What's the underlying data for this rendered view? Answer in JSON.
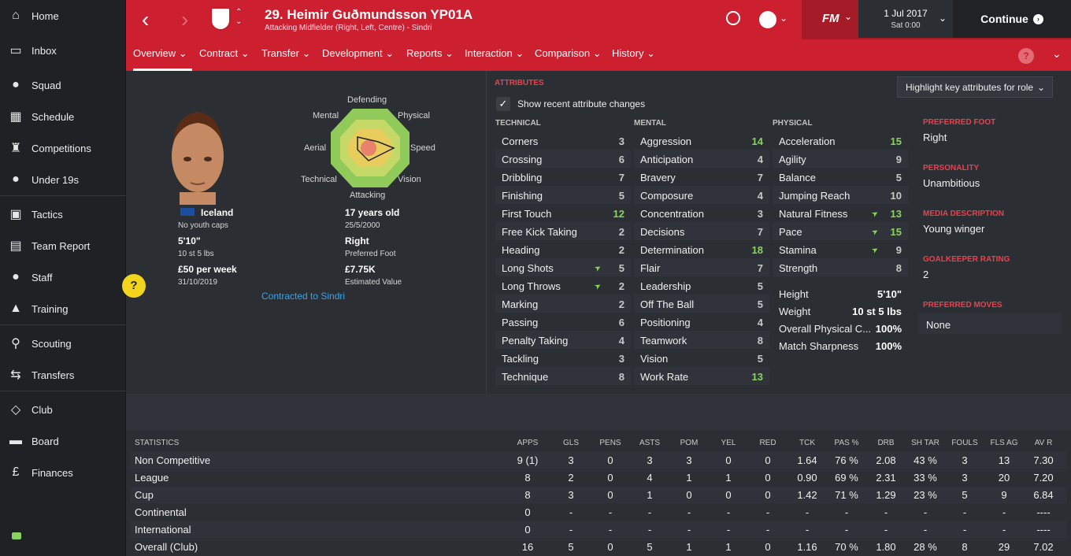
{
  "sidebar": {
    "items": [
      {
        "label": "Home",
        "icon": "home-icon"
      },
      {
        "label": "Inbox",
        "icon": "inbox-icon"
      },
      {
        "label": "Squad",
        "icon": "squad-icon"
      },
      {
        "label": "Schedule",
        "icon": "calendar-icon"
      },
      {
        "label": "Competitions",
        "icon": "trophy-icon"
      },
      {
        "label": "Under 19s",
        "icon": "under19s-icon"
      },
      {
        "label": "Tactics",
        "icon": "tactics-icon"
      },
      {
        "label": "Team Report",
        "icon": "report-icon"
      },
      {
        "label": "Staff",
        "icon": "staff-icon"
      },
      {
        "label": "Training",
        "icon": "training-icon"
      },
      {
        "label": "Scouting",
        "icon": "search-icon"
      },
      {
        "label": "Transfers",
        "icon": "transfers-icon"
      },
      {
        "label": "Club",
        "icon": "shield-icon"
      },
      {
        "label": "Board",
        "icon": "briefcase-icon"
      },
      {
        "label": "Finances",
        "icon": "pound-icon"
      }
    ]
  },
  "header": {
    "title": "29. Heimir Guðmundsson YP01A",
    "subtitle": "Attacking Midfielder (Right, Left, Centre) - Sindri",
    "fm_label": "FM",
    "date": "1 Jul 2017",
    "time": "Sat 0:00",
    "continue": "Continue"
  },
  "tabs": [
    "Overview",
    "Contract",
    "Transfer",
    "Development",
    "Reports",
    "Interaction",
    "Comparison",
    "History"
  ],
  "profile": {
    "nation": "Iceland",
    "caps": "No youth caps",
    "height": "5'10\"",
    "weight": "10 st 5 lbs",
    "wage": "£50 per week",
    "contract_end": "31/10/2019",
    "age": "17 years old",
    "dob": "25/5/2000",
    "foot": "Right",
    "foot_label": "Preferred Foot",
    "value": "£7.75K",
    "value_label": "Estimated Value",
    "contract_link": "Contracted to Sindri",
    "help": "?"
  },
  "radar": {
    "labels": [
      "Defending",
      "Physical",
      "Speed",
      "Vision",
      "Attacking",
      "Technical",
      "Aerial",
      "Mental"
    ]
  },
  "attributes": {
    "section_label": "ATTRIBUTES",
    "highlight_dropdown": "Highlight key attributes for role",
    "show_changes": "Show recent attribute changes",
    "technical_label": "TECHNICAL",
    "mental_label": "MENTAL",
    "physical_label": "PHYSICAL",
    "technical": [
      {
        "name": "Corners",
        "value": "3"
      },
      {
        "name": "Crossing",
        "value": "6"
      },
      {
        "name": "Dribbling",
        "value": "7"
      },
      {
        "name": "Finishing",
        "value": "5"
      },
      {
        "name": "First Touch",
        "value": "12",
        "hi": true
      },
      {
        "name": "Free Kick Taking",
        "value": "2"
      },
      {
        "name": "Heading",
        "value": "2"
      },
      {
        "name": "Long Shots",
        "value": "5",
        "arrow": true
      },
      {
        "name": "Long Throws",
        "value": "2",
        "arrow": true
      },
      {
        "name": "Marking",
        "value": "2"
      },
      {
        "name": "Passing",
        "value": "6"
      },
      {
        "name": "Penalty Taking",
        "value": "4"
      },
      {
        "name": "Tackling",
        "value": "3"
      },
      {
        "name": "Technique",
        "value": "8"
      }
    ],
    "mental": [
      {
        "name": "Aggression",
        "value": "14",
        "hi": true
      },
      {
        "name": "Anticipation",
        "value": "4"
      },
      {
        "name": "Bravery",
        "value": "7"
      },
      {
        "name": "Composure",
        "value": "4"
      },
      {
        "name": "Concentration",
        "value": "3"
      },
      {
        "name": "Decisions",
        "value": "7"
      },
      {
        "name": "Determination",
        "value": "18",
        "hi": true
      },
      {
        "name": "Flair",
        "value": "7"
      },
      {
        "name": "Leadership",
        "value": "5"
      },
      {
        "name": "Off The Ball",
        "value": "5"
      },
      {
        "name": "Positioning",
        "value": "4"
      },
      {
        "name": "Teamwork",
        "value": "8"
      },
      {
        "name": "Vision",
        "value": "5"
      },
      {
        "name": "Work Rate",
        "value": "13",
        "hi": true
      }
    ],
    "physical": [
      {
        "name": "Acceleration",
        "value": "15",
        "hi": true
      },
      {
        "name": "Agility",
        "value": "9"
      },
      {
        "name": "Balance",
        "value": "5"
      },
      {
        "name": "Jumping Reach",
        "value": "10"
      },
      {
        "name": "Natural Fitness",
        "value": "13",
        "hi": true,
        "arrow": true
      },
      {
        "name": "Pace",
        "value": "15",
        "hi": true,
        "arrow": true
      },
      {
        "name": "Stamina",
        "value": "9",
        "arrow": true
      },
      {
        "name": "Strength",
        "value": "8"
      }
    ],
    "physical_extra": [
      {
        "name": "Height",
        "value": "5'10\""
      },
      {
        "name": "Weight",
        "value": "10 st 5 lbs"
      },
      {
        "name": "Overall Physical C...",
        "value": "100%"
      },
      {
        "name": "Match Sharpness",
        "value": "100%"
      }
    ]
  },
  "side": {
    "foot_h": "PREFERRED FOOT",
    "foot_v": "Right",
    "pers_h": "PERSONALITY",
    "pers_v": "Unambitious",
    "media_h": "MEDIA DESCRIPTION",
    "media_v": "Young winger",
    "gk_h": "GOALKEEPER RATING",
    "gk_v": "2",
    "moves_h": "PREFERRED MOVES",
    "moves_v": "None"
  },
  "stats": {
    "title": "STATISTICS",
    "columns": [
      "APPS",
      "GLS",
      "PENS",
      "ASTS",
      "POM",
      "YEL",
      "RED",
      "TCK",
      "PAS %",
      "DRB",
      "SH TAR",
      "FOULS",
      "FLS AG",
      "AV R"
    ],
    "rows": [
      {
        "name": "Non Competitive",
        "cells": [
          "9 (1)",
          "3",
          "0",
          "3",
          "3",
          "0",
          "0",
          "1.64",
          "76 %",
          "2.08",
          "43 %",
          "3",
          "13",
          "7.30"
        ]
      },
      {
        "name": "League",
        "cells": [
          "8",
          "2",
          "0",
          "4",
          "1",
          "1",
          "0",
          "0.90",
          "69 %",
          "2.31",
          "33 %",
          "3",
          "20",
          "7.20"
        ]
      },
      {
        "name": "Cup",
        "cells": [
          "8",
          "3",
          "0",
          "1",
          "0",
          "0",
          "0",
          "1.42",
          "71 %",
          "1.29",
          "23 %",
          "5",
          "9",
          "6.84"
        ]
      },
      {
        "name": "Continental",
        "cells": [
          "0",
          "-",
          "-",
          "-",
          "-",
          "-",
          "-",
          "-",
          "-",
          "-",
          "-",
          "-",
          "-",
          "----"
        ]
      },
      {
        "name": "International",
        "cells": [
          "0",
          "-",
          "-",
          "-",
          "-",
          "-",
          "-",
          "-",
          "-",
          "-",
          "-",
          "-",
          "-",
          "----"
        ]
      },
      {
        "name": "Overall (Club)",
        "cells": [
          "16",
          "5",
          "0",
          "5",
          "1",
          "1",
          "0",
          "1.16",
          "70 %",
          "1.80",
          "28 %",
          "8",
          "29",
          "7.02"
        ]
      }
    ]
  }
}
